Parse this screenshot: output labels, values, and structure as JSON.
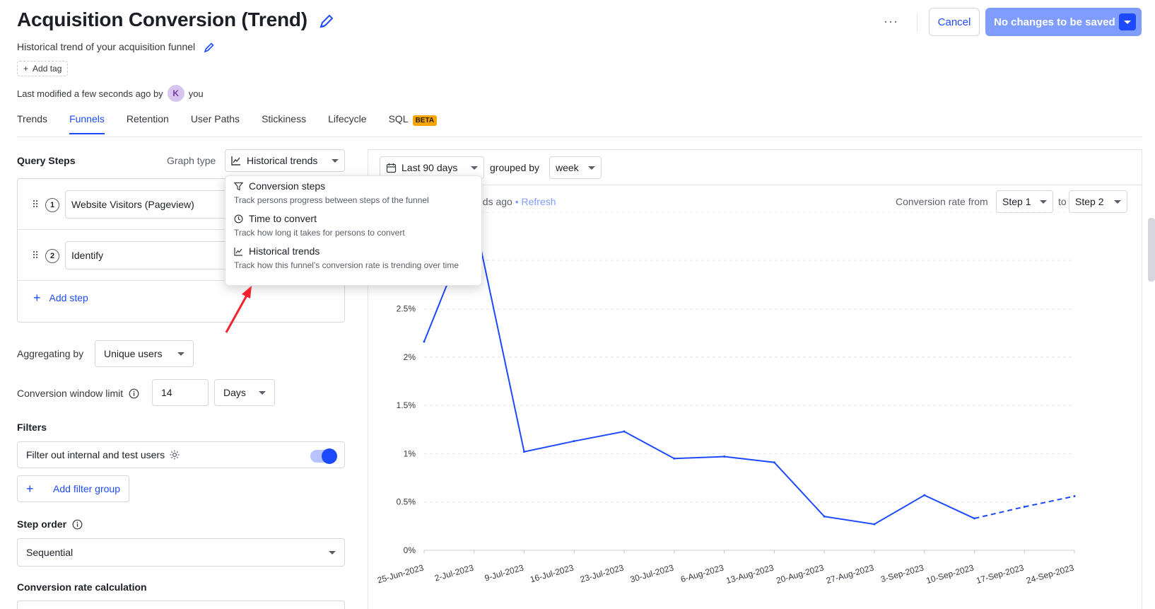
{
  "header": {
    "title": "Acquisition Conversion (Trend)",
    "subtitle": "Historical trend of your acquisition funnel",
    "add_tag": "Add tag",
    "last_modified_prefix": "Last modified a few seconds ago by",
    "avatar_initial": "K",
    "author": "you",
    "more": "···",
    "cancel": "Cancel",
    "save": "No changes to be saved"
  },
  "tabs": [
    {
      "label": "Trends",
      "active": false
    },
    {
      "label": "Funnels",
      "active": true
    },
    {
      "label": "Retention",
      "active": false
    },
    {
      "label": "User Paths",
      "active": false
    },
    {
      "label": "Stickiness",
      "active": false
    },
    {
      "label": "Lifecycle",
      "active": false
    },
    {
      "label": "SQL",
      "active": false,
      "badge": "BETA"
    }
  ],
  "query": {
    "title": "Query Steps",
    "graph_type_label": "Graph type",
    "graph_type_value": "Historical trends",
    "steps": [
      {
        "num": "1",
        "event": "Website Visitors (Pageview)"
      },
      {
        "num": "2",
        "event": "Identify"
      }
    ],
    "add_step": "Add step",
    "aggregating_label": "Aggregating by",
    "aggregating_value": "Unique users",
    "window_label": "Conversion window limit",
    "window_value": "14",
    "window_unit": "Days",
    "filters_title": "Filters",
    "filter_internal": "Filter out internal and test users",
    "filter_internal_on": true,
    "add_filter_group": "Add filter group",
    "step_order_title": "Step order",
    "step_order_value": "Sequential",
    "conversion_calc_title": "Conversion rate calculation"
  },
  "graph_type_menu": [
    {
      "title": "Conversion steps",
      "desc": "Track persons progress between steps of the funnel",
      "icon": "funnel-icon"
    },
    {
      "title": "Time to convert",
      "desc": "Track how long it takes for persons to convert",
      "icon": "clock-icon"
    },
    {
      "title": "Historical trends",
      "desc": "Track how this funnel's conversion rate is trending over time",
      "icon": "trend-icon"
    }
  ],
  "chart_controls": {
    "date_range": "Last 90 days",
    "grouped_by_label": "grouped by",
    "interval": "week",
    "computed_partial": "nds ago",
    "bullet": "•",
    "refresh": "Refresh",
    "rate_from_label": "Conversion rate from",
    "from_step": "Step 1",
    "to_label": "to",
    "to_step": "Step 2"
  },
  "colors": {
    "accent": "#1d4aff",
    "line": "#1d4aff",
    "badge": "#f7a501",
    "arrow": "#f5222d"
  },
  "chart_data": {
    "type": "line",
    "x": [
      "25-Jun-2023",
      "2-Jul-2023",
      "9-Jul-2023",
      "16-Jul-2023",
      "23-Jul-2023",
      "30-Jul-2023",
      "6-Aug-2023",
      "13-Aug-2023",
      "20-Aug-2023",
      "27-Aug-2023",
      "3-Sep-2023",
      "10-Sep-2023",
      "17-Sep-2023",
      "24-Sep-2023"
    ],
    "series": [
      {
        "values": [
          2.16,
          3.45,
          1.02,
          1.13,
          1.23,
          0.95,
          0.97,
          0.91,
          0.35,
          0.27,
          0.57,
          0.33,
          0.45,
          0.56
        ]
      }
    ],
    "dashed_from_index": 11,
    "y_ticks": [
      "0%",
      "0.5%",
      "1%",
      "1.5%",
      "2%",
      "2.5%"
    ],
    "ylim": [
      0,
      3.5
    ],
    "grid": true
  }
}
